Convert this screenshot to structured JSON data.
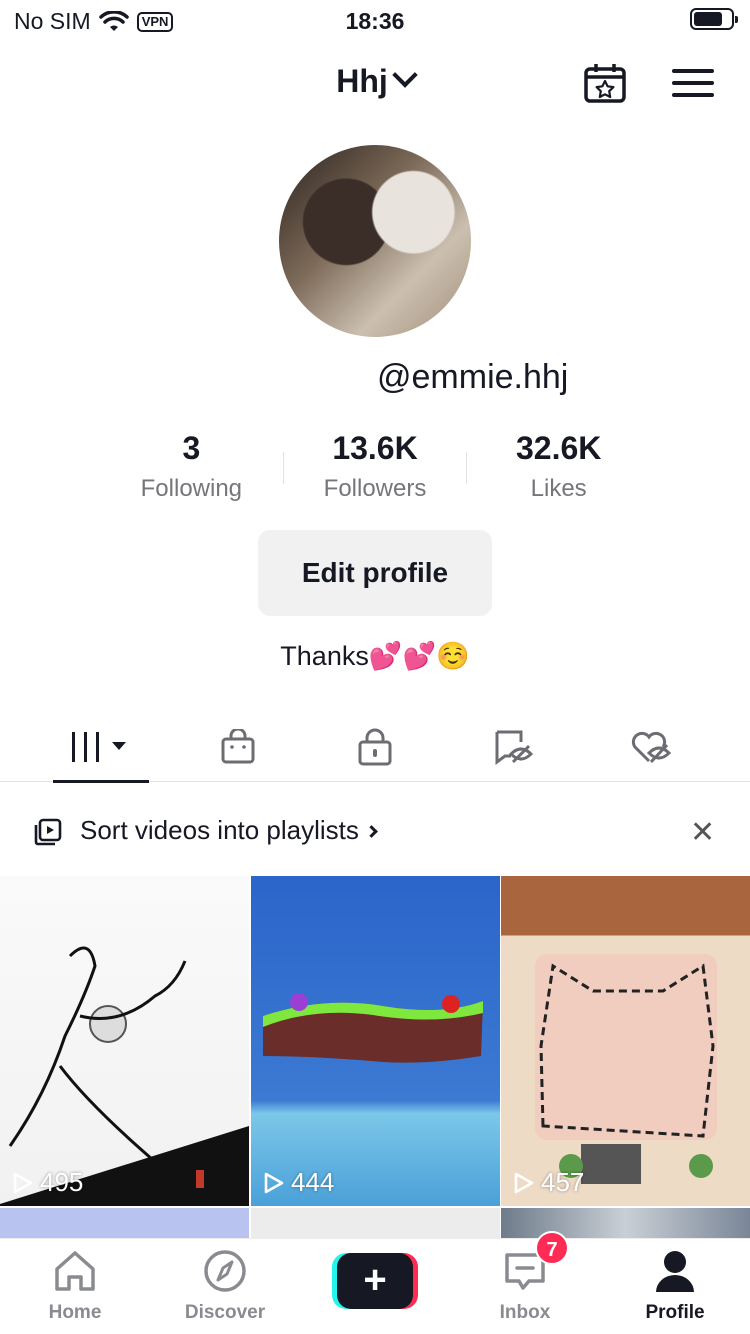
{
  "status_bar": {
    "carrier": "No SIM",
    "vpn": "VPN",
    "time": "18:36"
  },
  "header": {
    "title": "Hhj"
  },
  "profile": {
    "handle": "@emmie.hhj",
    "stats": [
      {
        "value": "3",
        "label": "Following"
      },
      {
        "value": "13.6K",
        "label": "Followers"
      },
      {
        "value": "32.6K",
        "label": "Likes"
      }
    ],
    "edit_label": "Edit profile",
    "bio": "Thanks💕💕☺️"
  },
  "playlist_banner": {
    "text": "Sort videos into playlists"
  },
  "videos": [
    {
      "views": "495"
    },
    {
      "views": "444"
    },
    {
      "views": "457"
    }
  ],
  "bottom_nav": {
    "home": "Home",
    "discover": "Discover",
    "inbox": "Inbox",
    "inbox_badge": "7",
    "profile": "Profile"
  }
}
